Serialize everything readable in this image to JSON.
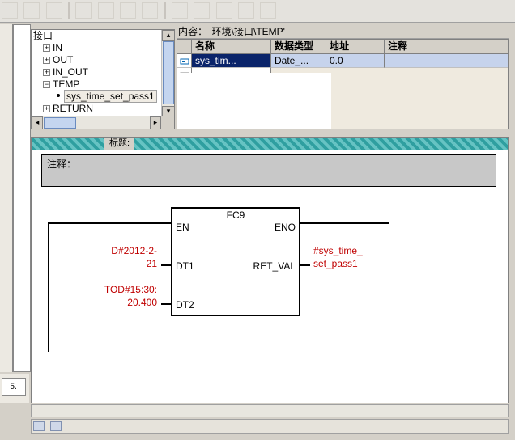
{
  "path_bar": {
    "prefix": "内容：",
    "value": "'环境\\接口\\TEMP'"
  },
  "tree": {
    "root_label": "接口",
    "items": [
      {
        "label": "IN"
      },
      {
        "label": "OUT"
      },
      {
        "label": "IN_OUT"
      },
      {
        "label": "TEMP",
        "children": [
          {
            "label": "sys_time_set_pass1"
          }
        ]
      },
      {
        "label": "RETURN"
      }
    ]
  },
  "grid": {
    "headers": {
      "name": "名称",
      "dtype": "数据类型",
      "addr": "地址",
      "comment": "注释"
    },
    "rows": [
      {
        "name": "sys_tim...",
        "dtype": "Date_...",
        "addr": "0.0",
        "comment": ""
      }
    ]
  },
  "editor": {
    "band_tag": "标题:",
    "comment_label": "注释：",
    "block": {
      "title": "FC9",
      "pins_left": [
        {
          "name": "EN"
        },
        {
          "name": "DT1"
        },
        {
          "name": "DT2"
        }
      ],
      "pins_right": [
        {
          "name": "ENO"
        },
        {
          "name": "RET_VAL"
        }
      ]
    },
    "inputs": {
      "dt1_line1": "D#2012-2-",
      "dt1_line2": "21",
      "dt2_line1": "TOD#15:30:",
      "dt2_line2": "20.400"
    },
    "outputs": {
      "retval_line1": "#sys_time_",
      "retval_line2": "set_pass1"
    }
  },
  "tab_stub": "5."
}
